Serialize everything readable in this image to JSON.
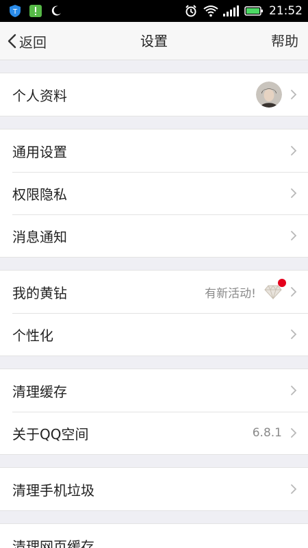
{
  "status_bar": {
    "time": "21:52"
  },
  "nav": {
    "back_label": "返回",
    "title": "设置",
    "help_label": "帮助"
  },
  "groups": [
    {
      "items": [
        {
          "label": "个人资料"
        }
      ]
    },
    {
      "items": [
        {
          "label": "通用设置"
        },
        {
          "label": "权限隐私"
        },
        {
          "label": "消息通知"
        }
      ]
    },
    {
      "items": [
        {
          "label": "我的黄钻",
          "value": "有新活动!"
        },
        {
          "label": "个性化"
        }
      ]
    },
    {
      "items": [
        {
          "label": "清理缓存"
        },
        {
          "label": "关于QQ空间",
          "value": "6.8.1"
        }
      ]
    },
    {
      "items": [
        {
          "label": "清理手机垃圾"
        }
      ]
    },
    {
      "items": [
        {
          "label": "清理网页缓存"
        }
      ]
    }
  ],
  "colors": {
    "accent_red": "#e4001c",
    "battery_green": "#4cd964"
  }
}
